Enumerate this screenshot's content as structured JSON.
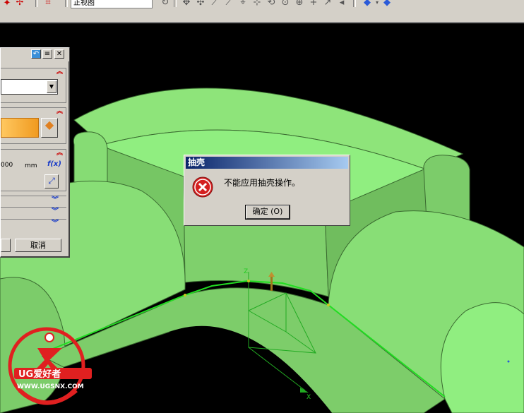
{
  "toolbar": {
    "view_combo": "正视图",
    "icons": [
      "rotate-icon",
      "snap-icon",
      "line-icon",
      "arc-icon",
      "point-icon",
      "circle-icon",
      "intersect-icon",
      "plus-icon",
      "arrow-icon",
      "shaded-cube-icon",
      "wire-cube-icon"
    ]
  },
  "left_panel": {
    "cancel_label": "取消",
    "value_text": "000",
    "unit": "mm",
    "fx_label": "f(x)"
  },
  "error_dialog": {
    "title": "抽壳",
    "message": "不能应用抽壳操作。",
    "ok_label": "确定 (O)"
  },
  "axes": {
    "z_label": "Z",
    "x_label": "X"
  },
  "watermark": {
    "brand": "UG爱好者",
    "url": "WWW.UGSNX.COM"
  },
  "colors": {
    "part_green": "#90ee80",
    "background": "#000000",
    "curve_green": "#22dd22",
    "dialog_title": "#0a246a",
    "error_red": "#d42020"
  }
}
